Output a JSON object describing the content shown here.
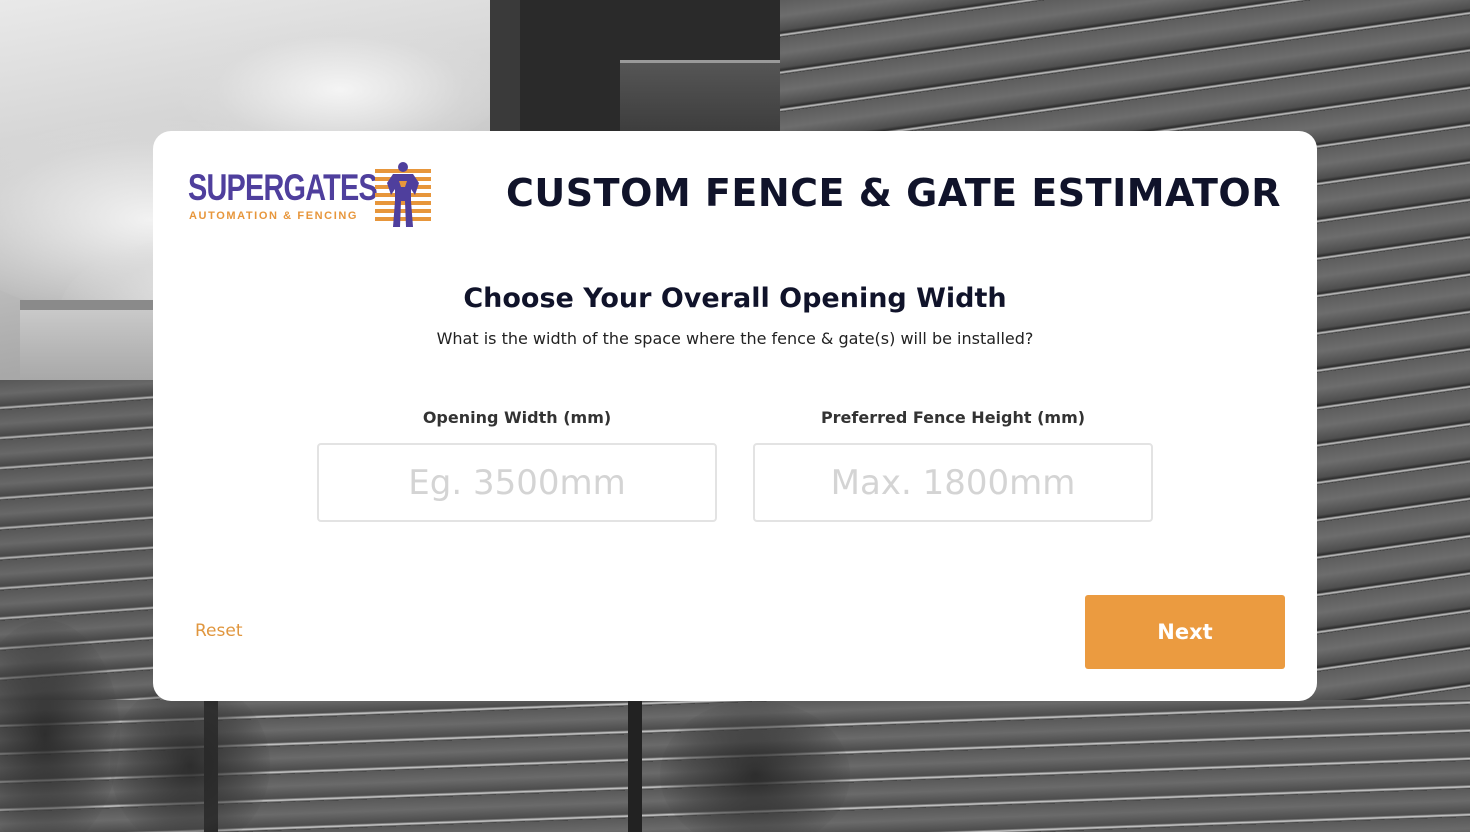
{
  "brand": {
    "name": "SUPERGATES",
    "tagline": "AUTOMATION & FENCING",
    "primary_color": "#4f3f9d",
    "accent_color": "#e7963b"
  },
  "header": {
    "title": "CUSTOM FENCE & GATE ESTIMATOR"
  },
  "step": {
    "heading": "Choose Your Overall Opening Width",
    "subheading": "What is the width of the space where the fence & gate(s) will be installed?"
  },
  "fields": {
    "width": {
      "label": "Opening Width (mm)",
      "value": "",
      "placeholder": "Eg. 3500mm"
    },
    "height": {
      "label": "Preferred Fence Height (mm)",
      "value": "",
      "placeholder": "Max. 1800mm"
    }
  },
  "actions": {
    "reset_label": "Reset",
    "next_label": "Next",
    "next_color": "#eb9b40"
  }
}
